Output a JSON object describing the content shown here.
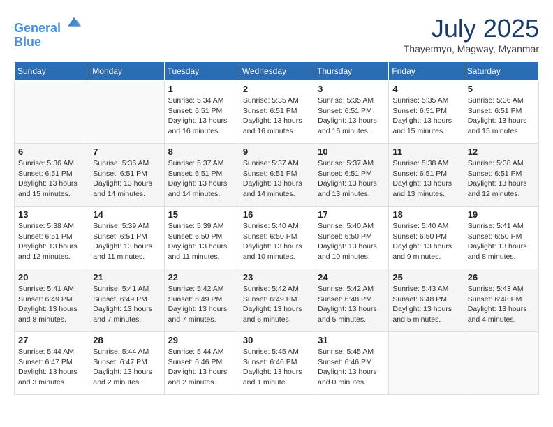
{
  "header": {
    "logo_line1": "General",
    "logo_line2": "Blue",
    "month_title": "July 2025",
    "subtitle": "Thayetmyo, Magway, Myanmar"
  },
  "days_of_week": [
    "Sunday",
    "Monday",
    "Tuesday",
    "Wednesday",
    "Thursday",
    "Friday",
    "Saturday"
  ],
  "weeks": [
    [
      {
        "day": "",
        "info": ""
      },
      {
        "day": "",
        "info": ""
      },
      {
        "day": "1",
        "info": "Sunrise: 5:34 AM\nSunset: 6:51 PM\nDaylight: 13 hours and 16 minutes."
      },
      {
        "day": "2",
        "info": "Sunrise: 5:35 AM\nSunset: 6:51 PM\nDaylight: 13 hours and 16 minutes."
      },
      {
        "day": "3",
        "info": "Sunrise: 5:35 AM\nSunset: 6:51 PM\nDaylight: 13 hours and 16 minutes."
      },
      {
        "day": "4",
        "info": "Sunrise: 5:35 AM\nSunset: 6:51 PM\nDaylight: 13 hours and 15 minutes."
      },
      {
        "day": "5",
        "info": "Sunrise: 5:36 AM\nSunset: 6:51 PM\nDaylight: 13 hours and 15 minutes."
      }
    ],
    [
      {
        "day": "6",
        "info": "Sunrise: 5:36 AM\nSunset: 6:51 PM\nDaylight: 13 hours and 15 minutes."
      },
      {
        "day": "7",
        "info": "Sunrise: 5:36 AM\nSunset: 6:51 PM\nDaylight: 13 hours and 14 minutes."
      },
      {
        "day": "8",
        "info": "Sunrise: 5:37 AM\nSunset: 6:51 PM\nDaylight: 13 hours and 14 minutes."
      },
      {
        "day": "9",
        "info": "Sunrise: 5:37 AM\nSunset: 6:51 PM\nDaylight: 13 hours and 14 minutes."
      },
      {
        "day": "10",
        "info": "Sunrise: 5:37 AM\nSunset: 6:51 PM\nDaylight: 13 hours and 13 minutes."
      },
      {
        "day": "11",
        "info": "Sunrise: 5:38 AM\nSunset: 6:51 PM\nDaylight: 13 hours and 13 minutes."
      },
      {
        "day": "12",
        "info": "Sunrise: 5:38 AM\nSunset: 6:51 PM\nDaylight: 13 hours and 12 minutes."
      }
    ],
    [
      {
        "day": "13",
        "info": "Sunrise: 5:38 AM\nSunset: 6:51 PM\nDaylight: 13 hours and 12 minutes."
      },
      {
        "day": "14",
        "info": "Sunrise: 5:39 AM\nSunset: 6:51 PM\nDaylight: 13 hours and 11 minutes."
      },
      {
        "day": "15",
        "info": "Sunrise: 5:39 AM\nSunset: 6:50 PM\nDaylight: 13 hours and 11 minutes."
      },
      {
        "day": "16",
        "info": "Sunrise: 5:40 AM\nSunset: 6:50 PM\nDaylight: 13 hours and 10 minutes."
      },
      {
        "day": "17",
        "info": "Sunrise: 5:40 AM\nSunset: 6:50 PM\nDaylight: 13 hours and 10 minutes."
      },
      {
        "day": "18",
        "info": "Sunrise: 5:40 AM\nSunset: 6:50 PM\nDaylight: 13 hours and 9 minutes."
      },
      {
        "day": "19",
        "info": "Sunrise: 5:41 AM\nSunset: 6:50 PM\nDaylight: 13 hours and 8 minutes."
      }
    ],
    [
      {
        "day": "20",
        "info": "Sunrise: 5:41 AM\nSunset: 6:49 PM\nDaylight: 13 hours and 8 minutes."
      },
      {
        "day": "21",
        "info": "Sunrise: 5:41 AM\nSunset: 6:49 PM\nDaylight: 13 hours and 7 minutes."
      },
      {
        "day": "22",
        "info": "Sunrise: 5:42 AM\nSunset: 6:49 PM\nDaylight: 13 hours and 7 minutes."
      },
      {
        "day": "23",
        "info": "Sunrise: 5:42 AM\nSunset: 6:49 PM\nDaylight: 13 hours and 6 minutes."
      },
      {
        "day": "24",
        "info": "Sunrise: 5:42 AM\nSunset: 6:48 PM\nDaylight: 13 hours and 5 minutes."
      },
      {
        "day": "25",
        "info": "Sunrise: 5:43 AM\nSunset: 6:48 PM\nDaylight: 13 hours and 5 minutes."
      },
      {
        "day": "26",
        "info": "Sunrise: 5:43 AM\nSunset: 6:48 PM\nDaylight: 13 hours and 4 minutes."
      }
    ],
    [
      {
        "day": "27",
        "info": "Sunrise: 5:44 AM\nSunset: 6:47 PM\nDaylight: 13 hours and 3 minutes."
      },
      {
        "day": "28",
        "info": "Sunrise: 5:44 AM\nSunset: 6:47 PM\nDaylight: 13 hours and 2 minutes."
      },
      {
        "day": "29",
        "info": "Sunrise: 5:44 AM\nSunset: 6:46 PM\nDaylight: 13 hours and 2 minutes."
      },
      {
        "day": "30",
        "info": "Sunrise: 5:45 AM\nSunset: 6:46 PM\nDaylight: 13 hours and 1 minute."
      },
      {
        "day": "31",
        "info": "Sunrise: 5:45 AM\nSunset: 6:46 PM\nDaylight: 13 hours and 0 minutes."
      },
      {
        "day": "",
        "info": ""
      },
      {
        "day": "",
        "info": ""
      }
    ]
  ]
}
